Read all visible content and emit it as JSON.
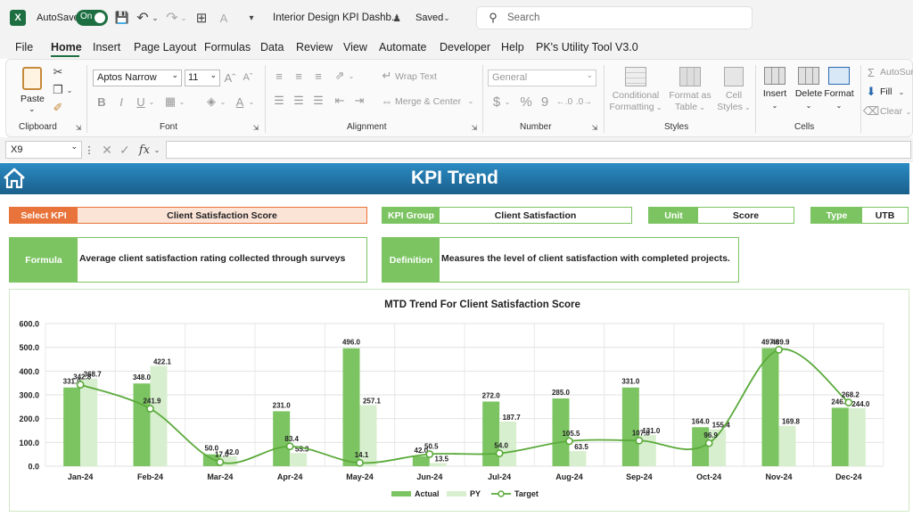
{
  "titlebar": {
    "autosave_label": "AutoSave",
    "autosave_state": "On",
    "doc_title": "Interior Design KPI Dashb...",
    "saved_status": "Saved",
    "search_placeholder": "Search"
  },
  "menu": [
    "File",
    "Home",
    "Insert",
    "Page Layout",
    "Formulas",
    "Data",
    "Review",
    "View",
    "Automate",
    "Developer",
    "Help",
    "PK's Utility Tool V3.0"
  ],
  "ribbon": {
    "clipboard": {
      "paste": "Paste",
      "label": "Clipboard"
    },
    "font": {
      "name": "Aptos Narrow",
      "size": "11",
      "label": "Font",
      "bold": "B",
      "italic": "I",
      "underline": "U"
    },
    "alignment": {
      "wrap": "Wrap Text",
      "merge": "Merge & Center",
      "label": "Alignment"
    },
    "number": {
      "format": "General",
      "label": "Number",
      "currency": "$",
      "percent": "%",
      "comma": "9"
    },
    "styles": {
      "conditional": "Conditional",
      "conditional2": "Formatting",
      "format_as": "Format as",
      "format_as2": "Table",
      "cell": "Cell",
      "cell2": "Styles",
      "label": "Styles"
    },
    "cells": {
      "insert": "Insert",
      "delete": "Delete",
      "format": "Format",
      "label": "Cells"
    },
    "editing": {
      "autosum": "AutoSum",
      "fill": "Fill",
      "clear": "Clear"
    }
  },
  "formulabar": {
    "namebox": "X9",
    "fx": "fx"
  },
  "dashboard": {
    "title": "KPI Trend",
    "select_kpi_label": "Select KPI",
    "select_kpi_value": "Client Satisfaction Score",
    "kpi_group_label": "KPI Group",
    "kpi_group_value": "Client Satisfaction",
    "unit_label": "Unit",
    "unit_value": "Score",
    "type_label": "Type",
    "type_value": "UTB",
    "formula_label": "Formula",
    "formula_value": "Average client satisfaction rating collected through surveys",
    "definition_label": "Definition",
    "definition_value": "Measures the level of client satisfaction with completed projects."
  },
  "colors": {
    "actual": "#7cc462",
    "py": "#d8efcf",
    "target": "#5aaa3a",
    "label_orange": "#e8743b",
    "select_fill": "#fbe3d6",
    "banner": "#1f6f9e"
  },
  "chart_data": {
    "type": "bar",
    "title": "MTD Trend For Client Satisfaction Score",
    "categories": [
      "Jan-24",
      "Feb-24",
      "Mar-24",
      "Apr-24",
      "May-24",
      "Jun-24",
      "Jul-24",
      "Aug-24",
      "Sep-24",
      "Oct-24",
      "Nov-24",
      "Dec-24"
    ],
    "series": [
      {
        "name": "Actual",
        "type": "bar",
        "values": [
          331.0,
          348.0,
          50.0,
          231.0,
          496.0,
          42.0,
          272.0,
          285.0,
          331.0,
          164.0,
          497.0,
          246.0
        ]
      },
      {
        "name": "PY",
        "type": "bar",
        "values": [
          368.7,
          422.1,
          42.0,
          55.3,
          257.1,
          13.5,
          187.7,
          63.5,
          131.0,
          155.4,
          169.8,
          244.0
        ]
      },
      {
        "name": "Target",
        "type": "line",
        "values": [
          342.8,
          241.9,
          17.0,
          83.4,
          14.1,
          50.5,
          54.0,
          105.5,
          107.8,
          96.9,
          489.9,
          268.2
        ]
      }
    ],
    "actual_labels": [
      "331.0",
      "348.0",
      "50.0",
      "231.0",
      "496.0",
      "42.0",
      "272.0",
      "285.0",
      "331.0",
      "164.0",
      "497.0",
      "246.0"
    ],
    "py_labels": [
      "368.7",
      "422.1",
      "42.0",
      "55.3",
      "257.1",
      "13.5",
      "187.7",
      "63.5",
      "131.0",
      "155.4",
      "169.8",
      "244.0"
    ],
    "target_labels": [
      "342.8",
      "241.9",
      "17.0",
      "83.4",
      "14.1",
      "50.5",
      "54.0",
      "105.5",
      "107.8",
      "96.9",
      "489.9",
      "268.2"
    ],
    "y_ticks": [
      "600.0",
      "500.0",
      "400.0",
      "300.0",
      "200.0",
      "100.0",
      "0.0"
    ],
    "ylim": [
      0,
      600
    ],
    "grid": true,
    "legend_position": "bottom"
  }
}
